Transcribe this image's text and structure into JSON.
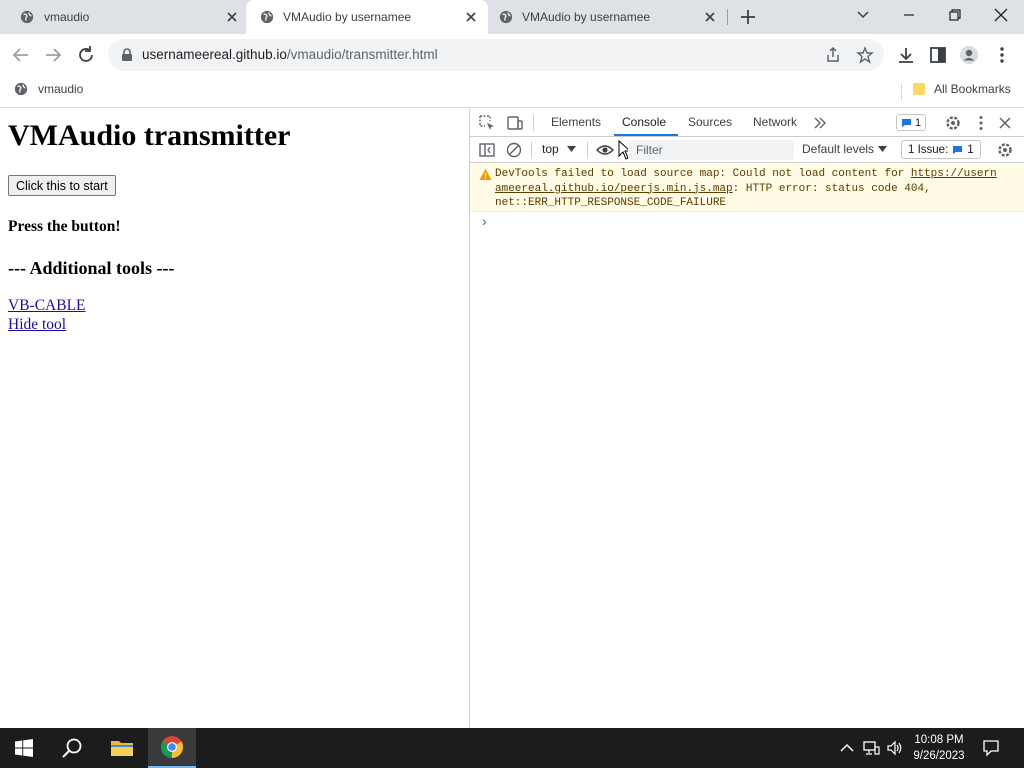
{
  "browser": {
    "tabs": [
      {
        "title": "vmaudio",
        "active": false
      },
      {
        "title": "VMAudio by usernamee",
        "active": true
      },
      {
        "title": "VMAudio by usernamee",
        "active": false
      }
    ],
    "url_host": "usernameereal.github.io",
    "url_path": "/vmaudio/transmitter.html",
    "bookmarks": [
      {
        "label": "vmaudio"
      }
    ],
    "all_bookmarks_label": "All Bookmarks"
  },
  "page": {
    "heading": "VMAudio transmitter",
    "start_button": "Click this to start",
    "status_text": "Press the button!",
    "additional_tools": "--- Additional tools ---",
    "links": [
      "VB-CABLE",
      "Hide tool"
    ]
  },
  "devtools": {
    "tabs": [
      "Elements",
      "Console",
      "Sources",
      "Network"
    ],
    "active_tab": "Console",
    "messages_badge": "1",
    "context": "top",
    "filter_placeholder": "Filter",
    "levels": "Default levels",
    "issues_label": "1 Issue:",
    "issues_count": "1",
    "warning": {
      "text_before": "DevTools failed to load source map: Could not load content for ",
      "link": "https://usernameereal.github.io/peerjs.min.js.map",
      "link_line1": "https://usern",
      "link_line2": "ameereal.github.io/peerjs.min.js.map",
      "text_after": ": HTTP error: status code 404,",
      "text_line3": "net::ERR_HTTP_RESPONSE_CODE_FAILURE"
    },
    "prompt": "›"
  },
  "taskbar": {
    "time": "10:08 PM",
    "date": "9/26/2023"
  },
  "colors": {
    "tabstrip_bg": "#dee1e6",
    "link": "#1a0dab",
    "devtools_accent": "#1a73e8",
    "warning_bg": "#fffbe5",
    "taskbar_bg": "#1c1c1c"
  }
}
